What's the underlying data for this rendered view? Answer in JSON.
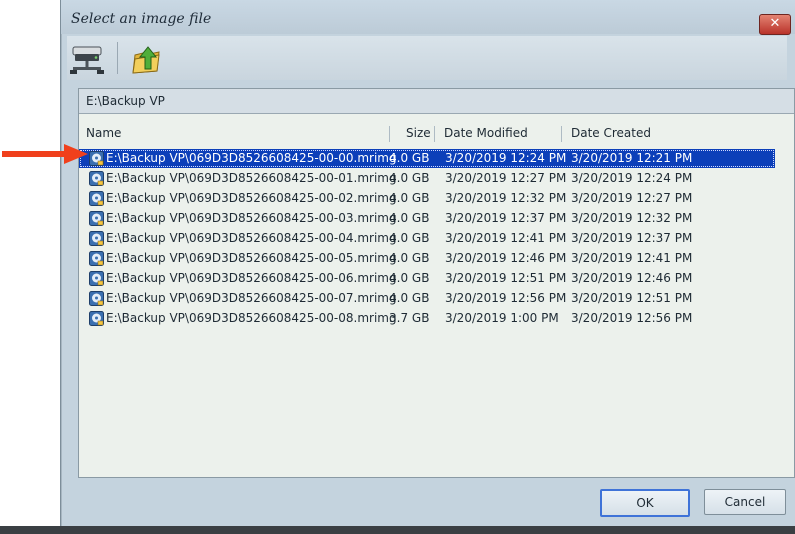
{
  "window": {
    "title": "Select an image file",
    "close_glyph": "✕"
  },
  "toolbar": {
    "buttons": [
      {
        "icon": "network-drive-icon"
      },
      {
        "icon": "up-folder-icon"
      }
    ]
  },
  "path": "E:\\Backup VP",
  "columns": {
    "name": "Name",
    "size": "Size",
    "modified": "Date Modified",
    "created": "Date Created"
  },
  "files": [
    {
      "name": "E:\\Backup VP\\069D3D8526608425-00-00.mrimg",
      "size": "4.0 GB",
      "modified": "3/20/2019 12:24 PM",
      "created": "3/20/2019 12:21 PM",
      "selected": true
    },
    {
      "name": "E:\\Backup VP\\069D3D8526608425-00-01.mrimg",
      "size": "4.0 GB",
      "modified": "3/20/2019 12:27 PM",
      "created": "3/20/2019 12:24 PM"
    },
    {
      "name": "E:\\Backup VP\\069D3D8526608425-00-02.mrimg",
      "size": "4.0 GB",
      "modified": "3/20/2019 12:32 PM",
      "created": "3/20/2019 12:27 PM"
    },
    {
      "name": "E:\\Backup VP\\069D3D8526608425-00-03.mrimg",
      "size": "4.0 GB",
      "modified": "3/20/2019 12:37 PM",
      "created": "3/20/2019 12:32 PM"
    },
    {
      "name": "E:\\Backup VP\\069D3D8526608425-00-04.mrimg",
      "size": "4.0 GB",
      "modified": "3/20/2019 12:41 PM",
      "created": "3/20/2019 12:37 PM"
    },
    {
      "name": "E:\\Backup VP\\069D3D8526608425-00-05.mrimg",
      "size": "4.0 GB",
      "modified": "3/20/2019 12:46 PM",
      "created": "3/20/2019 12:41 PM"
    },
    {
      "name": "E:\\Backup VP\\069D3D8526608425-00-06.mrimg",
      "size": "4.0 GB",
      "modified": "3/20/2019 12:51 PM",
      "created": "3/20/2019 12:46 PM"
    },
    {
      "name": "E:\\Backup VP\\069D3D8526608425-00-07.mrimg",
      "size": "4.0 GB",
      "modified": "3/20/2019 12:56 PM",
      "created": "3/20/2019 12:51 PM"
    },
    {
      "name": "E:\\Backup VP\\069D3D8526608425-00-08.mrimg",
      "size": "3.7 GB",
      "modified": "3/20/2019 1:00 PM",
      "created": "3/20/2019 12:56 PM"
    }
  ],
  "buttons": {
    "ok": "OK",
    "cancel": "Cancel"
  },
  "colors": {
    "selection": "#0c3fb9",
    "annotation_arrow": "#f0401c"
  }
}
